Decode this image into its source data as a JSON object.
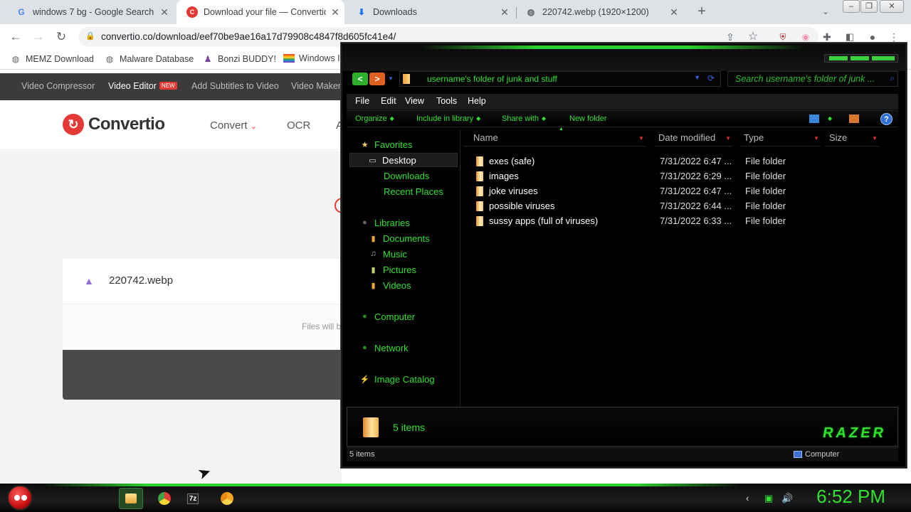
{
  "browser": {
    "tabs": [
      {
        "title": "windows 7 bg - Google Search",
        "icon": "google-icon"
      },
      {
        "title": "Download your file — Convertio",
        "icon": "convertio-icon"
      },
      {
        "title": "Downloads",
        "icon": "download-icon"
      },
      {
        "title": "220742.webp (1920×1200)",
        "icon": "globe-icon"
      }
    ],
    "url": "convertio.co/download/eef70be9ae16a17d79908c4847f8d605fc41e4/",
    "bookmarks": [
      {
        "label": "MEMZ Download"
      },
      {
        "label": "Malware Database"
      },
      {
        "label": "Bonzi BUDDY!"
      },
      {
        "label": "Windows I"
      }
    ]
  },
  "convertio": {
    "topnav": {
      "video_compressor": "Video Compressor",
      "video_editor": "Video Editor",
      "new_badge": "NEW",
      "add_subtitles": "Add Subtitles to Video",
      "video_maker": "Video Maker"
    },
    "logo_text": "Convertio",
    "menu": {
      "convert": "Convert",
      "ocr": "OCR",
      "a": "A"
    },
    "file_name": "220742.webp",
    "files_note": "Files will b"
  },
  "explorer": {
    "address_path": "username's folder of junk and stuff",
    "search_placeholder": "Search username's folder of junk ...",
    "menu": [
      "File",
      "Edit",
      "View",
      "Tools",
      "Help"
    ],
    "commands": [
      "Organize",
      "Include in library",
      "Share with",
      "New folder"
    ],
    "help_label": "?",
    "nav": {
      "favorites": "Favorites",
      "desktop": "Desktop",
      "downloads": "Downloads",
      "recent_places": "Recent Places",
      "libraries": "Libraries",
      "documents": "Documents",
      "music": "Music",
      "pictures": "Pictures",
      "videos": "Videos",
      "computer": "Computer",
      "network": "Network",
      "image_catalog": "Image Catalog"
    },
    "columns": {
      "name": "Name",
      "date": "Date modified",
      "type": "Type",
      "size": "Size"
    },
    "files": [
      {
        "name": "exes (safe)",
        "date": "7/31/2022 6:47 ...",
        "type": "File folder"
      },
      {
        "name": "images",
        "date": "7/31/2022 6:29 ...",
        "type": "File folder"
      },
      {
        "name": "joke viruses",
        "date": "7/31/2022 6:47 ...",
        "type": "File folder"
      },
      {
        "name": "possible viruses",
        "date": "7/31/2022 6:44 ...",
        "type": "File folder"
      },
      {
        "name": "sussy apps (full of viruses)",
        "date": "7/31/2022 6:33 ...",
        "type": "File folder"
      }
    ],
    "details_count": "5 items",
    "theme_logo": "RAZER",
    "status_left": "5 items",
    "status_right": "Computer"
  },
  "taskbar": {
    "clock": "6:52 PM",
    "apps": [
      "file-explorer",
      "chrome",
      "7zip",
      "chrome-canary"
    ],
    "accent": "#2fe02f"
  }
}
